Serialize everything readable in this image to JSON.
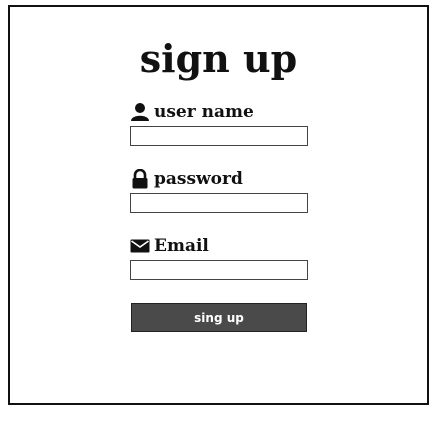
{
  "form": {
    "title": "sign up",
    "fields": [
      {
        "label": "user name",
        "icon": "user-icon",
        "value": "",
        "placeholder": ""
      },
      {
        "label": "password",
        "icon": "lock-icon",
        "value": "",
        "placeholder": ""
      },
      {
        "label": "Email",
        "icon": "envelope-icon",
        "value": "",
        "placeholder": ""
      }
    ],
    "submit_label": "sing up"
  },
  "colors": {
    "text": "#111111",
    "button_bg": "#4a4a4a",
    "button_text": "#ffffff",
    "border": "#111111"
  }
}
